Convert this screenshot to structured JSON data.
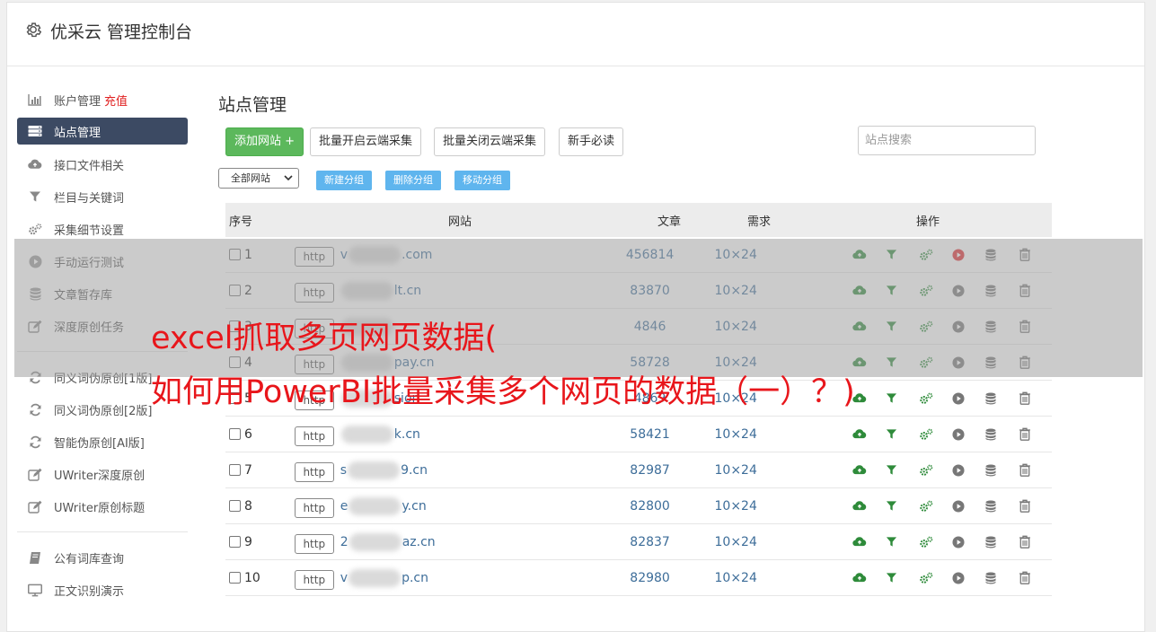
{
  "header": {
    "title": "优采云 管理控制台"
  },
  "sidebar": {
    "items": [
      {
        "label": "账户管理",
        "icon": "bar-chart-icon",
        "extra": "充值"
      },
      {
        "label": "站点管理",
        "icon": "server-icon",
        "active": true
      },
      {
        "label": "接口文件相关",
        "icon": "cloud-upload-icon"
      },
      {
        "label": "栏目与关键词",
        "icon": "filter-icon"
      },
      {
        "label": "采集细节设置",
        "icon": "gears-icon"
      },
      {
        "label": "手动运行测试",
        "icon": "play-circle-icon"
      },
      {
        "label": "文章暂存库",
        "icon": "database-icon"
      },
      {
        "label": "深度原创任务",
        "icon": "edit-icon"
      }
    ],
    "items2": [
      {
        "label": "同义词伪原创[1版]",
        "icon": "refresh-icon"
      },
      {
        "label": "同义词伪原创[2版]",
        "icon": "refresh-icon"
      },
      {
        "label": "智能伪原创[AI版]",
        "icon": "refresh-icon"
      },
      {
        "label": "UWriter深度原创",
        "icon": "edit-icon"
      },
      {
        "label": "UWriter原创标题",
        "icon": "edit-icon"
      }
    ],
    "items3": [
      {
        "label": "公有词库查询",
        "icon": "book-icon"
      },
      {
        "label": "正文识别演示",
        "icon": "monitor-icon"
      }
    ]
  },
  "main": {
    "title": "站点管理",
    "buttons": {
      "add_site": "添加网站 +",
      "batch_open": "批量开启云端采集",
      "batch_close": "批量关闭云端采集",
      "newbie": "新手必读"
    },
    "search_placeholder": "站点搜索",
    "group_select": "全部网站",
    "group_buttons": {
      "new": "新建分组",
      "delete": "删除分组",
      "move": "移动分组"
    }
  },
  "table": {
    "headers": {
      "no": "序号",
      "site": "网站",
      "articles": "文章",
      "demand": "需求",
      "ops": "操作"
    },
    "rows": [
      {
        "no": "1",
        "scheme": "http",
        "pre": "v",
        "post": ".com",
        "articles": "456814",
        "demand": "10×24",
        "play_active": true
      },
      {
        "no": "2",
        "scheme": "http",
        "pre": "",
        "post": "lt.cn",
        "articles": "83870",
        "demand": "10×24"
      },
      {
        "no": "3",
        "scheme": "http",
        "pre": "",
        "post": "",
        "articles": "4846",
        "demand": "10×24"
      },
      {
        "no": "4",
        "scheme": "http",
        "pre": "",
        "post": "pay.cn",
        "articles": "58728",
        "demand": "10×24"
      },
      {
        "no": "5",
        "scheme": "http",
        "pre": "",
        "post": "sion",
        "articles": "4869",
        "demand": "10×24"
      },
      {
        "no": "6",
        "scheme": "http",
        "pre": "",
        "post": "k.cn",
        "articles": "58421",
        "demand": "10×24"
      },
      {
        "no": "7",
        "scheme": "http",
        "pre": "s",
        "post": "9.cn",
        "articles": "82987",
        "demand": "10×24"
      },
      {
        "no": "8",
        "scheme": "http",
        "pre": "e",
        "post": "y.cn",
        "articles": "82800",
        "demand": "10×24"
      },
      {
        "no": "9",
        "scheme": "http",
        "pre": "2",
        "post": "az.cn",
        "articles": "82837",
        "demand": "10×24"
      },
      {
        "no": "10",
        "scheme": "http",
        "pre": "v",
        "post": "p.cn",
        "articles": "82980",
        "demand": "10×24"
      }
    ]
  },
  "overlay": {
    "line1": "excel抓取多页网页数据(",
    "line2": "如何用PowerBI批量采集多个网页的数据（一）？)"
  },
  "colors": {
    "accent_red": "#e8161b",
    "green": "#5cb85c",
    "blue_btn": "#5fb5ee",
    "active_nav": "#3c4a63",
    "link": "#3d6d99"
  }
}
